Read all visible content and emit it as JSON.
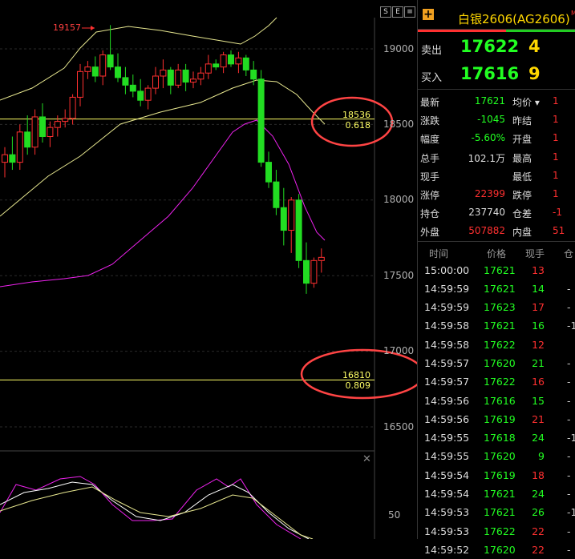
{
  "chart": {
    "price_axis": [
      "19000",
      "18500",
      "18000",
      "17500",
      "17000",
      "16500"
    ],
    "peak_label": "19157",
    "fib_upper": {
      "price": "18536",
      "ratio": "0.618"
    },
    "fib_lower": {
      "price": "16810",
      "ratio": "0.809"
    },
    "sub_axis_label": "50",
    "strip_btn_s": "S",
    "strip_btn_e": "E"
  },
  "colors": {
    "up": "#ff3030",
    "down": "#22dd22",
    "fib": "#ffff66",
    "magenta": "#ee22ee",
    "white": "#ffffff",
    "yellow": "#e8e890"
  },
  "quote": {
    "title": "白银2606(AG2606)",
    "m_badge": "M",
    "ask": {
      "label": "卖出",
      "price": "17622",
      "volume": "4"
    },
    "bid": {
      "label": "买入",
      "price": "17616",
      "volume": "9"
    },
    "stats": [
      {
        "label": "最新",
        "value": "17621",
        "vcolor": "#22ff22",
        "label2": "均价 ▾",
        "value2": "1"
      },
      {
        "label": "涨跌",
        "value": "-1045",
        "vcolor": "#22ff22",
        "label2": "昨结",
        "value2": "1"
      },
      {
        "label": "幅度",
        "value": "-5.60%",
        "vcolor": "#22ff22",
        "label2": "开盘",
        "value2": "1"
      },
      {
        "label": "总手",
        "value": "102.1万",
        "vcolor": "#dddddd",
        "label2": "最高",
        "value2": "1"
      },
      {
        "label": "现手",
        "value": "",
        "vcolor": "#dddddd",
        "label2": "最低",
        "value2": "1"
      },
      {
        "label": "涨停",
        "value": "22399",
        "vcolor": "#ff3030",
        "label2": "跌停",
        "value2": "1"
      },
      {
        "label": "持仓",
        "value": "237740",
        "vcolor": "#dddddd",
        "label2": "仓差",
        "value2": "-1"
      },
      {
        "label": "外盘",
        "value": "507882",
        "vcolor": "#ff3030",
        "label2": "内盘",
        "value2": "51"
      }
    ],
    "tick_headers": {
      "time": "时间",
      "price": "价格",
      "volume": "现手",
      "oi": "仓"
    },
    "ticks": [
      {
        "time": "15:00:00",
        "price": "17621",
        "volume": "13",
        "vcolor": "#ff3030",
        "oi": ""
      },
      {
        "time": "14:59:59",
        "price": "17621",
        "volume": "14",
        "vcolor": "#22ff22",
        "oi": "-"
      },
      {
        "time": "14:59:59",
        "price": "17623",
        "volume": "17",
        "vcolor": "#ff3030",
        "oi": "-"
      },
      {
        "time": "14:59:58",
        "price": "17621",
        "volume": "16",
        "vcolor": "#22ff22",
        "oi": "-1"
      },
      {
        "time": "14:59:58",
        "price": "17622",
        "volume": "12",
        "vcolor": "#ff3030",
        "oi": ""
      },
      {
        "time": "14:59:57",
        "price": "17620",
        "volume": "21",
        "vcolor": "#22ff22",
        "oi": "-"
      },
      {
        "time": "14:59:57",
        "price": "17622",
        "volume": "16",
        "vcolor": "#ff3030",
        "oi": "-"
      },
      {
        "time": "14:59:56",
        "price": "17616",
        "volume": "15",
        "vcolor": "#22ff22",
        "oi": "-"
      },
      {
        "time": "14:59:56",
        "price": "17619",
        "volume": "21",
        "vcolor": "#ff3030",
        "oi": "-"
      },
      {
        "time": "14:59:55",
        "price": "17618",
        "volume": "24",
        "vcolor": "#22ff22",
        "oi": "-1"
      },
      {
        "time": "14:59:55",
        "price": "17620",
        "volume": "9",
        "vcolor": "#22ff22",
        "oi": "-"
      },
      {
        "time": "14:59:54",
        "price": "17619",
        "volume": "18",
        "vcolor": "#ff3030",
        "oi": "-"
      },
      {
        "time": "14:59:54",
        "price": "17621",
        "volume": "24",
        "vcolor": "#22ff22",
        "oi": "-"
      },
      {
        "time": "14:59:53",
        "price": "17621",
        "volume": "26",
        "vcolor": "#22ff22",
        "oi": "-1"
      },
      {
        "time": "14:59:53",
        "price": "17622",
        "volume": "22",
        "vcolor": "#ff3030",
        "oi": "-"
      },
      {
        "time": "14:59:52",
        "price": "17620",
        "volume": "22",
        "vcolor": "#ff3030",
        "oi": "-"
      }
    ]
  },
  "candles": [
    [
      18250,
      18350,
      18150,
      18300
    ],
    [
      18300,
      18420,
      18200,
      18250
    ],
    [
      18250,
      18500,
      18200,
      18450
    ],
    [
      18450,
      18560,
      18300,
      18350
    ],
    [
      18350,
      18600,
      18300,
      18550
    ],
    [
      18550,
      18640,
      18380,
      18420
    ],
    [
      18420,
      18520,
      18350,
      18480
    ],
    [
      18480,
      18560,
      18420,
      18520
    ],
    [
      18520,
      18600,
      18480,
      18540
    ],
    [
      18540,
      18700,
      18500,
      18680
    ],
    [
      18680,
      18900,
      18620,
      18850
    ],
    [
      18850,
      18920,
      18800,
      18880
    ],
    [
      18880,
      18950,
      18780,
      18820
    ],
    [
      18820,
      18990,
      18760,
      18960
    ],
    [
      18960,
      19157,
      18860,
      18880
    ],
    [
      18880,
      18970,
      18780,
      18810
    ],
    [
      18810,
      18880,
      18700,
      18760
    ],
    [
      18760,
      18830,
      18680,
      18720
    ],
    [
      18720,
      18800,
      18620,
      18660
    ],
    [
      18660,
      18760,
      18600,
      18740
    ],
    [
      18740,
      18880,
      18700,
      18820
    ],
    [
      18820,
      18930,
      18740,
      18860
    ],
    [
      18860,
      18880,
      18700,
      18760
    ],
    [
      18760,
      18900,
      18740,
      18860
    ],
    [
      18860,
      18900,
      18720,
      18780
    ],
    [
      18780,
      18850,
      18740,
      18800
    ],
    [
      18800,
      18880,
      18760,
      18840
    ],
    [
      18840,
      18960,
      18800,
      18900
    ],
    [
      18900,
      18930,
      18860,
      18880
    ],
    [
      18880,
      18980,
      18840,
      18960
    ],
    [
      18960,
      18990,
      18880,
      18900
    ],
    [
      18900,
      18980,
      18840,
      18940
    ],
    [
      18940,
      18960,
      18820,
      18860
    ],
    [
      18860,
      18920,
      18760,
      18800
    ],
    [
      18800,
      18860,
      18220,
      18250
    ],
    [
      18250,
      18320,
      18080,
      18120
    ],
    [
      18120,
      18200,
      17900,
      17950
    ],
    [
      17950,
      18080,
      17700,
      17800
    ],
    [
      17800,
      18020,
      17650,
      18000
    ],
    [
      18000,
      18040,
      17550,
      17600
    ],
    [
      17600,
      17720,
      17380,
      17450
    ],
    [
      17450,
      17620,
      17420,
      17600
    ],
    [
      17600,
      17680,
      17520,
      17621
    ]
  ]
}
